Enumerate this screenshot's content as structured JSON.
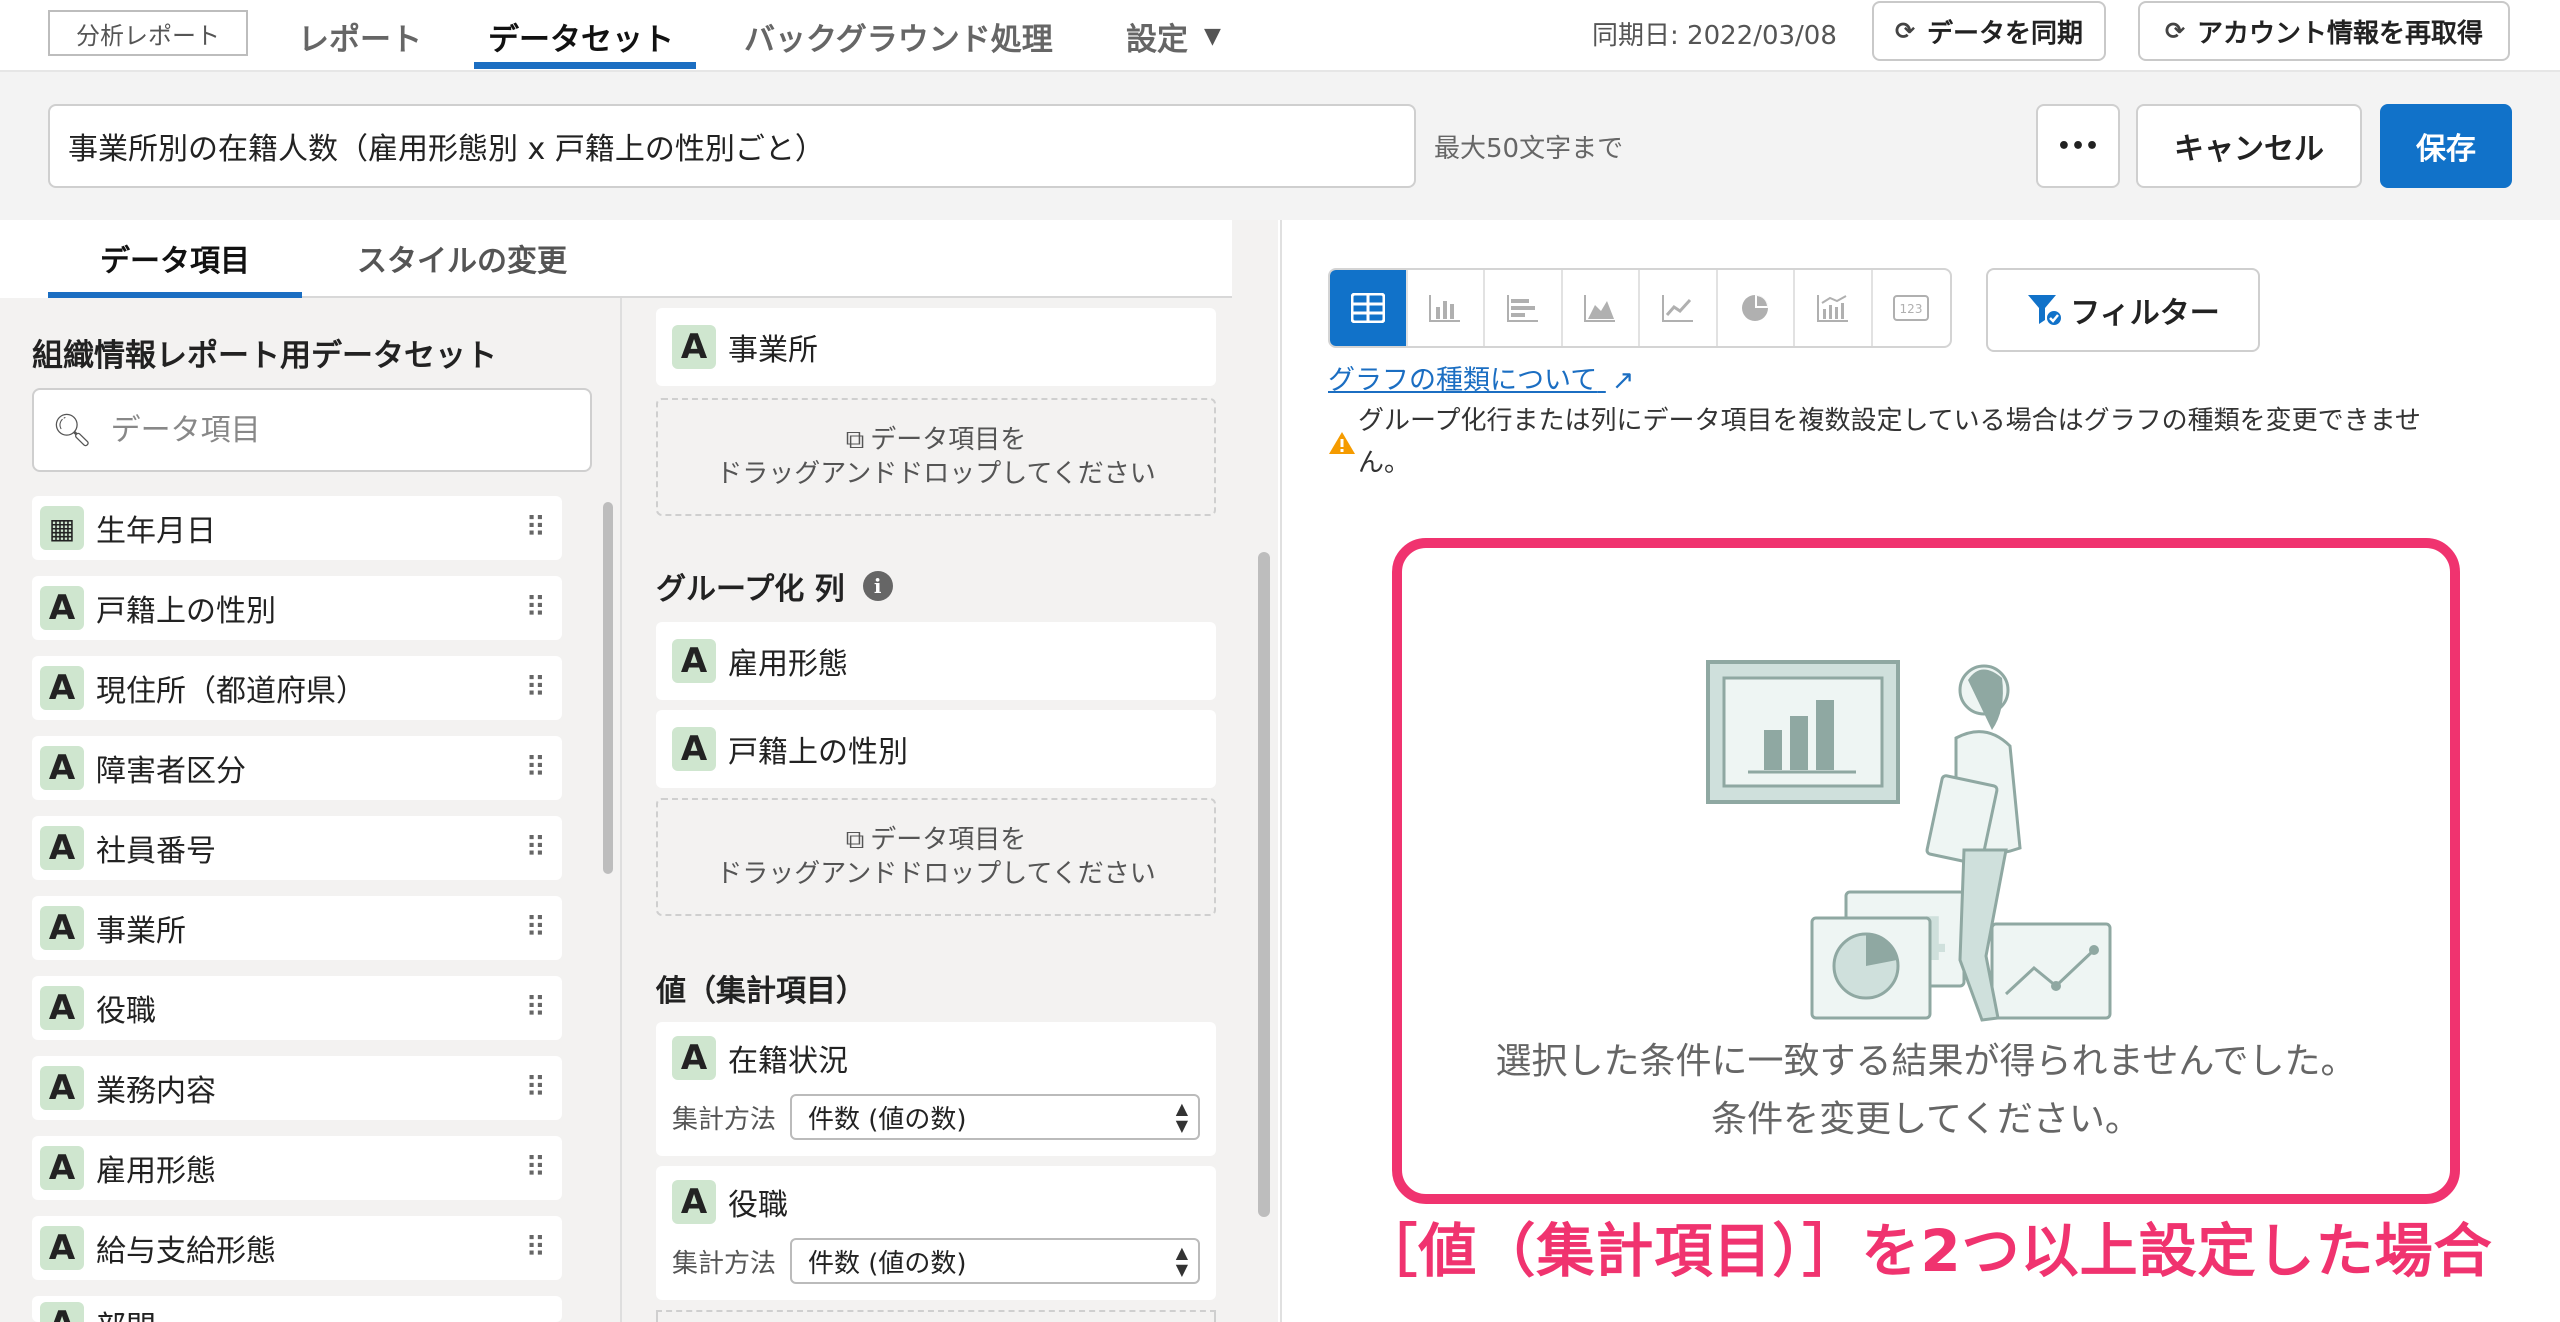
{
  "nav": {
    "brand": "分析レポート",
    "tabs": [
      "レポート",
      "データセット",
      "バックグラウンド処理",
      "設定"
    ],
    "sync_date": "同期日: 2022/03/08",
    "sync_button": "データを同期",
    "reacquire_button": "アカウント情報を再取得"
  },
  "header": {
    "title_value": "事業所別の在籍人数（雇用形態別 x 戸籍上の性別ごと）",
    "title_hint": "最大50文字まで",
    "more_label": "•••",
    "cancel_label": "キャンセル",
    "save_label": "保存"
  },
  "left_tabs": [
    "データ項目",
    "スタイルの変更"
  ],
  "fields": {
    "dataset_title": "組織情報レポート用データセット",
    "search_placeholder": "データ項目",
    "items": [
      {
        "type": "date",
        "label": "生年月日"
      },
      {
        "type": "A",
        "label": "戸籍上の性別"
      },
      {
        "type": "A",
        "label": "現住所（都道府県）"
      },
      {
        "type": "A",
        "label": "障害者区分"
      },
      {
        "type": "A",
        "label": "社員番号"
      },
      {
        "type": "A",
        "label": "事業所"
      },
      {
        "type": "A",
        "label": "役職"
      },
      {
        "type": "A",
        "label": "業務内容"
      },
      {
        "type": "A",
        "label": "雇用形態"
      },
      {
        "type": "A",
        "label": "給与支給形態"
      },
      {
        "type": "A",
        "label": "部門"
      }
    ]
  },
  "config": {
    "row_item": "事業所",
    "dropzone_line1": "データ項目を",
    "dropzone_line2": "ドラッグアンドドロップしてください",
    "group_columns_title": "グループ化 列",
    "group_columns": [
      "雇用形態",
      "戸籍上の性別"
    ],
    "values_title": "値（集計項目）",
    "values": [
      {
        "label": "在籍状況",
        "agg_label": "集計方法",
        "agg_value": "件数 (値の数)"
      },
      {
        "label": "役職",
        "agg_label": "集計方法",
        "agg_value": "件数 (値の数)"
      }
    ]
  },
  "right": {
    "chart_types": [
      "table",
      "column",
      "bar",
      "area",
      "line",
      "pie",
      "combo",
      "number"
    ],
    "active_chart_type": "table",
    "filter_label": "フィルター",
    "graph_link": "グラフの種類について",
    "warning_line1": "グループ化行または列にデータ項目を複数設定している場合はグラフの種類を変更できませ",
    "warning_line2": "ん。",
    "empty_line1": "選択した条件に一致する結果が得られませんでした。",
    "empty_line2": "条件を変更してください。",
    "caption": "［値（集計項目）］を2つ以上設定した場合"
  },
  "colors": {
    "accent": "#1172c9",
    "highlight": "#f0336f",
    "badge": "#cfe6cf"
  }
}
